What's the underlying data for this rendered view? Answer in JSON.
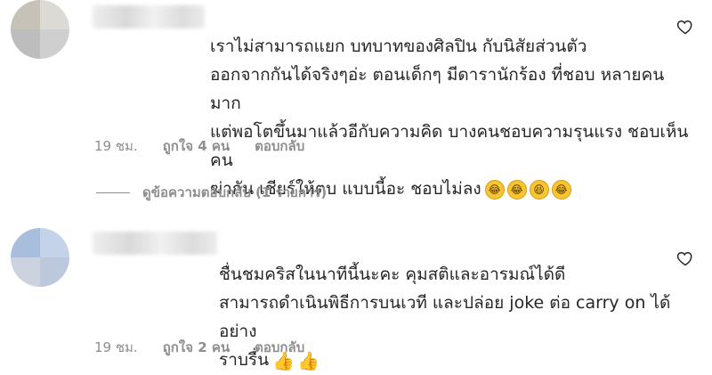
{
  "comments": [
    {
      "text": "เราไม่สามารถแยก บทบาทของศิลปิน กับนิสัยส่วนตัว\nออกจากกันได้จริงๆอ่ะ ตอนเด็กๆ มีดารานักร้อง ที่ชอบ หลายคนมาก\nแต่พอโตขึ้นมาแล้วอีกับความคิด บางคนชอบความรุนแรง ชอบเห็นคน\nฆ่ากัน เชียร์ให้ตบ แบบนี้อะ ชอบไม่ลง",
      "emojis": [
        "rolling-laughing-face",
        "rolling-laughing-face",
        "grinning-squinting-face",
        "rolling-laughing-face"
      ],
      "time": "19 ชม.",
      "likes": "ถูกใจ 4 คน",
      "reply": "ตอบกลับ",
      "avatar_colors": [
        "#c7c2b7",
        "#dcdad4",
        "#bdbdbd",
        "#cfcfcf"
      ]
    },
    {
      "text": "ชื่นชมคริสในนาทีนี้นะคะ คุมสติและอารมณ์ได้ดี\nสามารถดำเนินพิธีการบนเวที และปล่อย joke ต่อ carry on ได้อย่าง\nราบรื่น",
      "emojis": [
        "thumbs-up",
        "thumbs-up"
      ],
      "time": "19 ชม.",
      "likes": "ถูกใจ 2 คน",
      "reply": "ตอบกลับ",
      "avatar_colors": [
        "#a9bedc",
        "#c5d3ea",
        "#cdd3de",
        "#bcc8dc"
      ]
    }
  ],
  "view_replies": "ดูข้อความตอบกลับ (1 รายการ)"
}
